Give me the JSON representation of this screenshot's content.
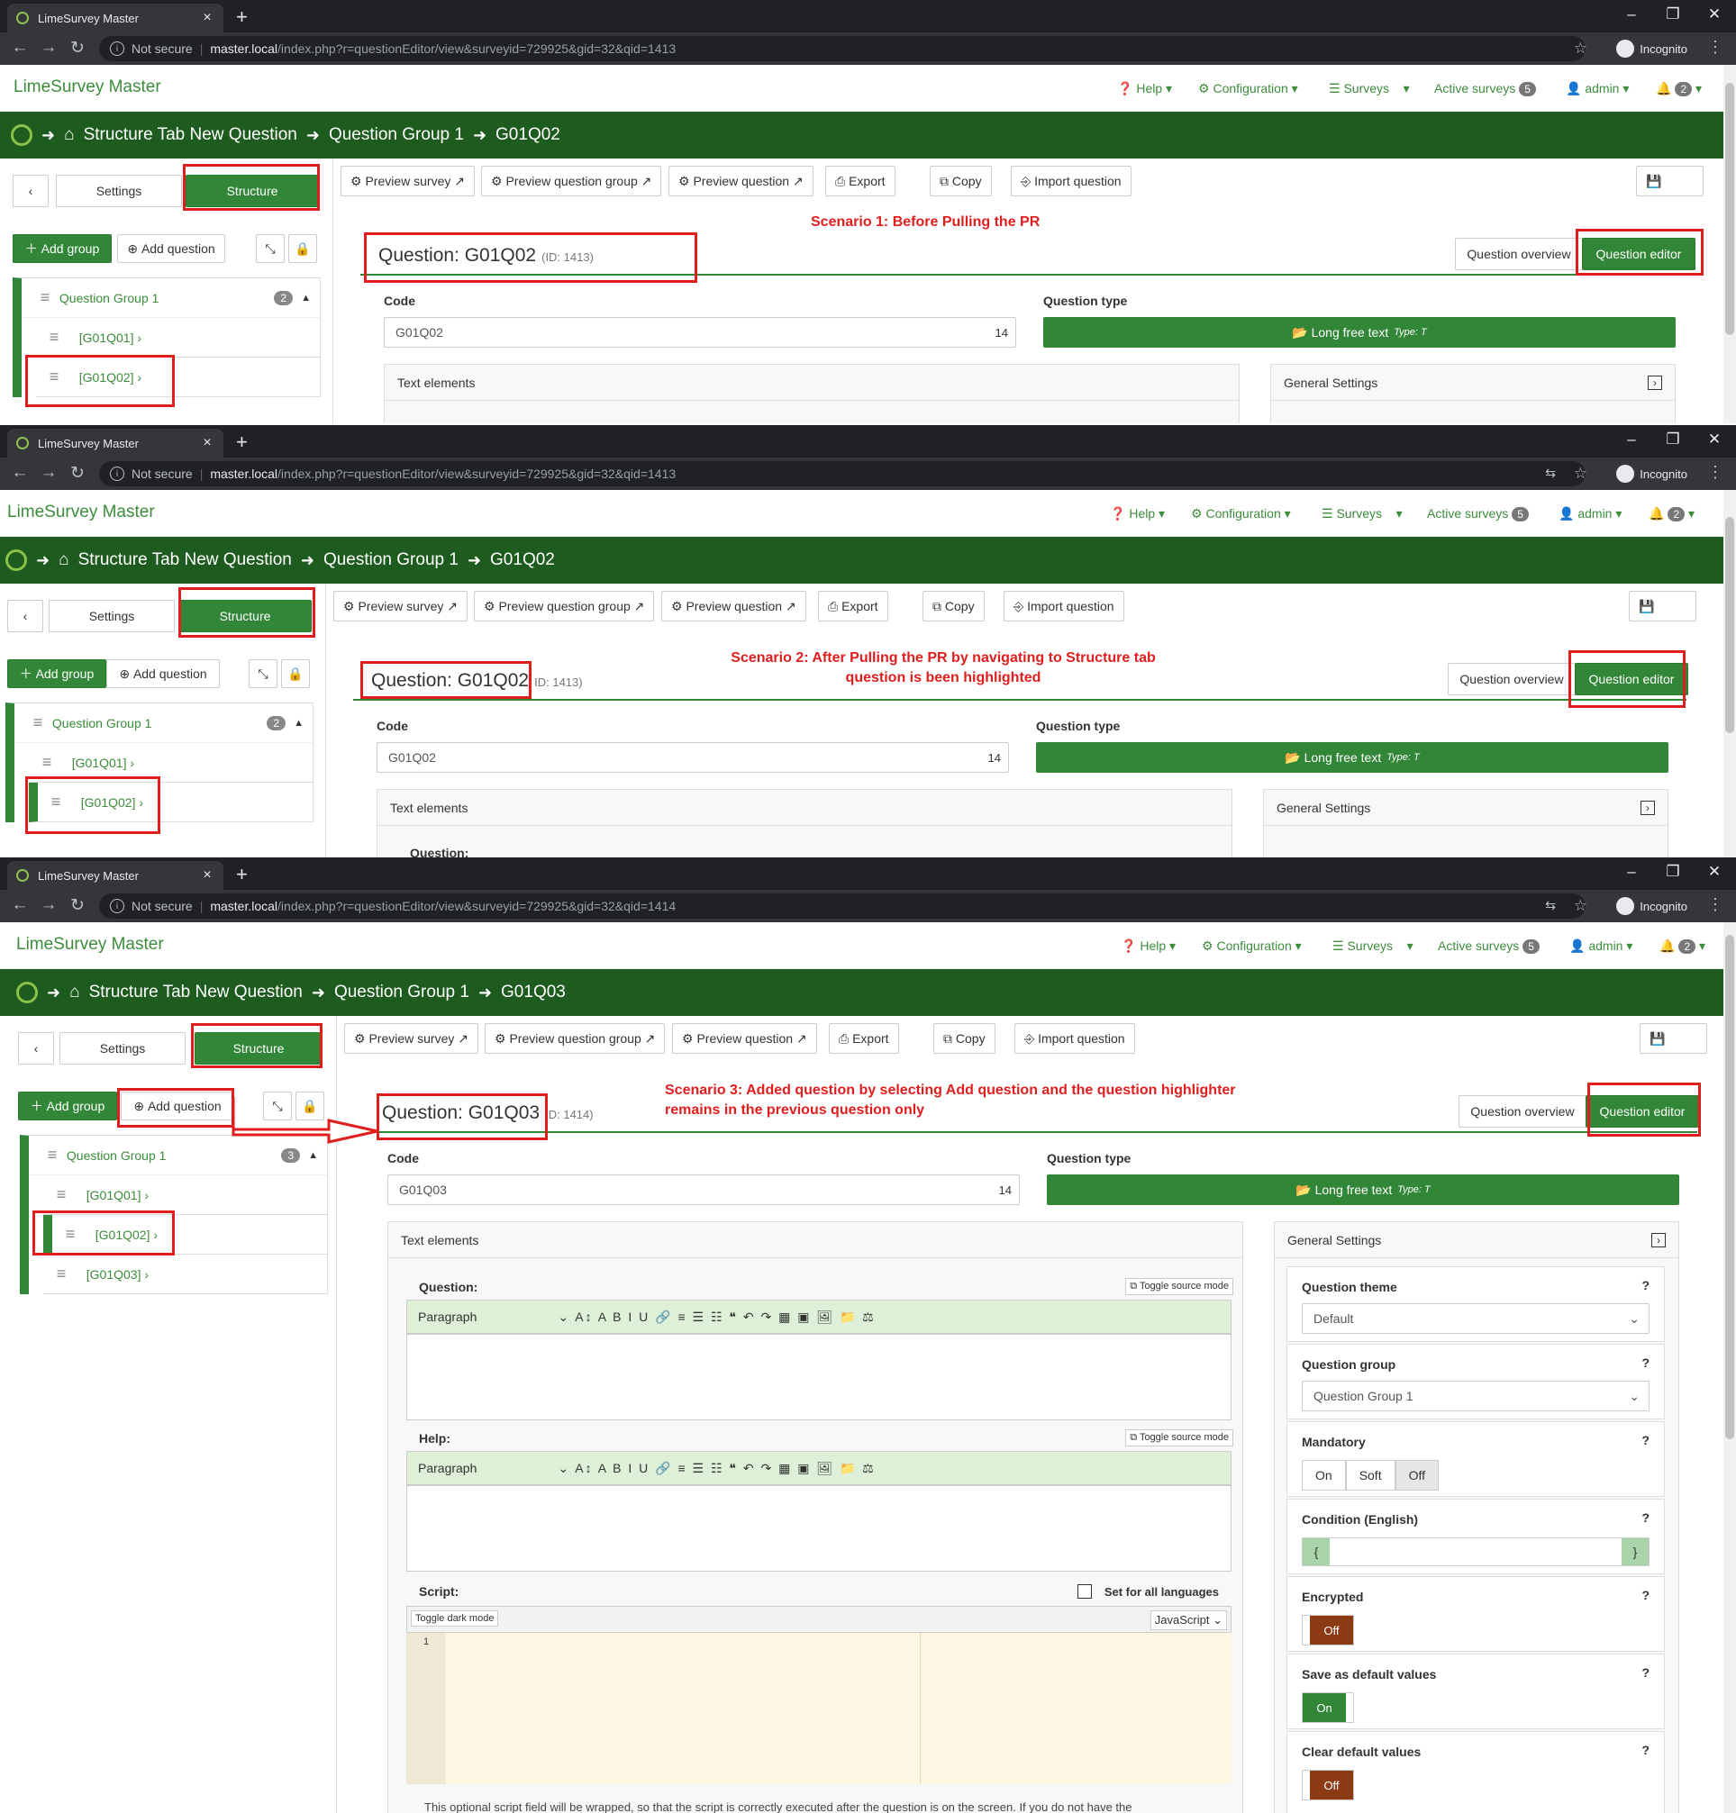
{
  "browser": {
    "tab_title": "LimeSurvey Master",
    "not_secure": "Not secure",
    "host": "master.local",
    "path_1413": "/index.php?r=questionEditor/view&surveyid=729925&gid=32&qid=1413",
    "path_1414": "/index.php?r=questionEditor/view&surveyid=729925&gid=32&qid=1414",
    "incognito": "Incognito"
  },
  "nav": {
    "brand": "LimeSurvey Master",
    "help": "Help",
    "configuration": "Configuration",
    "surveys": "Surveys",
    "active_surveys": "Active surveys",
    "active_count": "5",
    "admin": "admin",
    "notif_count": "2"
  },
  "breadcrumb": {
    "survey": "Structure Tab New Question",
    "group": "Question Group 1",
    "q2": "G01Q02",
    "q3": "G01Q03"
  },
  "sidebar": {
    "settings_tab": "Settings",
    "structure_tab": "Structure",
    "add_group": "Add group",
    "add_question": "Add question",
    "group_name": "Question Group 1",
    "count_2": "2",
    "count_3": "3",
    "q1": "[G01Q01]",
    "q2": "[G01Q02]",
    "q3": "[G01Q03]"
  },
  "toolbar": {
    "preview_survey": "Preview survey",
    "preview_group": "Preview question group",
    "preview_question": "Preview question",
    "export": "Export",
    "copy": "Copy",
    "import": "Import question",
    "save": "Save"
  },
  "question": {
    "title_2": "Question: G01Q02",
    "title_3": "Question: G01Q03",
    "id_1413": "(ID: 1413)",
    "id_1413_cut": "ID: 1413)",
    "id_1414": "ID: 1414)",
    "overview": "Question overview",
    "editor": "Question editor",
    "code_label": "Code",
    "code_2": "G01Q02",
    "code_3": "G01Q03",
    "code_len": "14",
    "type_label": "Question type",
    "type_value": "Long free text",
    "type_code": "Type: T",
    "text_elements": "Text elements",
    "general_settings": "General Settings",
    "question_label": "Question:",
    "help_label": "Help:",
    "script_label": "Script:",
    "toggle_source": "Toggle source mode",
    "paragraph": "Paragraph",
    "set_all_langs": "Set for all languages",
    "toggle_dark": "Toggle dark mode",
    "js": "JavaScript",
    "line_1": "1",
    "script_note": "This optional script field will be wrapped, so that the script is correctly executed after the question is on the screen. If you do not have the"
  },
  "general": {
    "theme_label": "Question theme",
    "theme_value": "Default",
    "group_label": "Question group",
    "group_value": "Question Group 1",
    "mandatory_label": "Mandatory",
    "on": "On",
    "soft": "Soft",
    "off": "Off",
    "condition_label": "Condition (English)",
    "encrypted_label": "Encrypted",
    "save_default_label": "Save as default values",
    "clear_default_label": "Clear default values",
    "help_mark": "?"
  },
  "annotations": {
    "s1": "Scenario 1: Before Pulling the PR",
    "s2a": "Scenario 2: After Pulling the PR by navigating to Structure tab",
    "s2b": "question is been highlighted",
    "s3a": "Scenario 3: Added question by selecting Add question and the question highlighter",
    "s3b": "remains in the previous question only"
  },
  "colors": {
    "brand_green": "#328637",
    "dark_green": "#1e5b1e",
    "annotation_red": "#e01e1e"
  }
}
